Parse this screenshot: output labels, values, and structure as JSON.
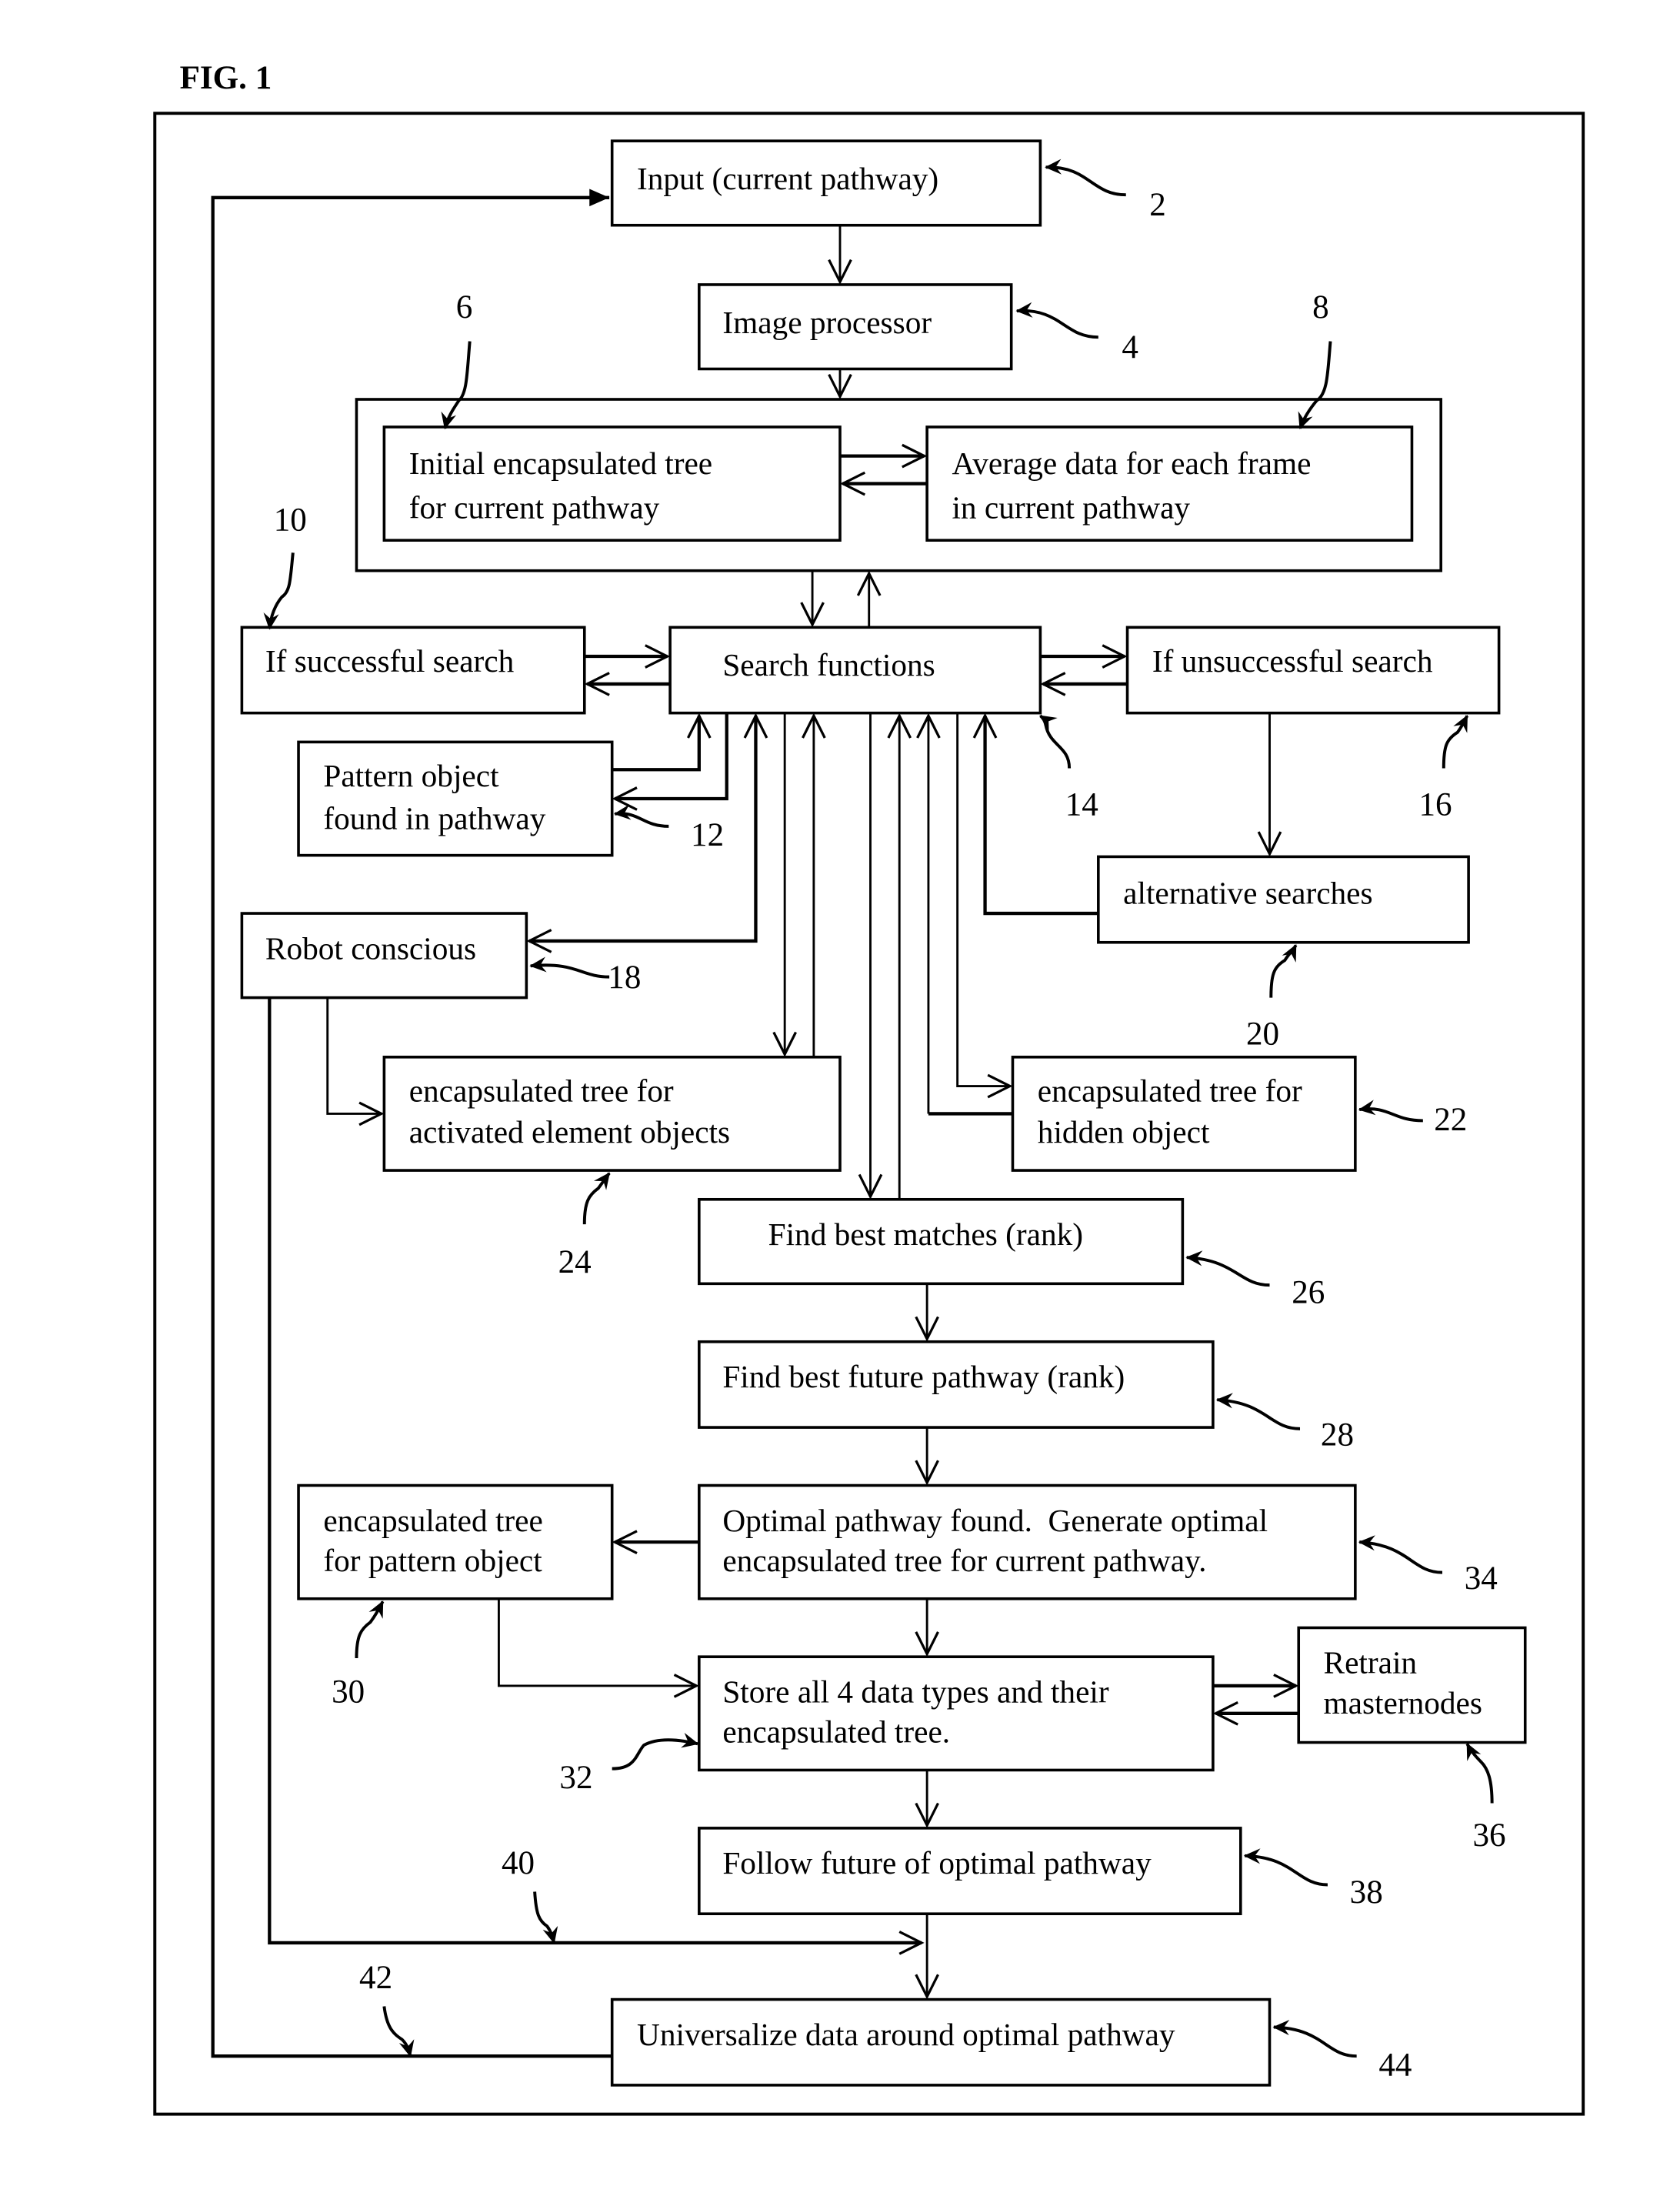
{
  "figure_label": "FIG. 1",
  "boxes": {
    "input": {
      "lines": [
        "Input (current pathway)"
      ],
      "ref": "2"
    },
    "image_processor": {
      "lines": [
        "Image processor"
      ],
      "ref": "4"
    },
    "initial_tree": {
      "lines": [
        "Initial encapsulated tree",
        "for current pathway"
      ],
      "ref": "6"
    },
    "average_data": {
      "lines": [
        "Average data for each frame",
        "in current pathway"
      ],
      "ref": "8"
    },
    "successful_search": {
      "lines": [
        "If successful search"
      ],
      "ref": "10"
    },
    "pattern_found": {
      "lines": [
        "Pattern object",
        "found in pathway"
      ],
      "ref": "12"
    },
    "search_functions": {
      "lines": [
        "Search functions"
      ],
      "ref": "14"
    },
    "unsuccessful_search": {
      "lines": [
        "If unsuccessful search"
      ],
      "ref": "16"
    },
    "robot_conscious": {
      "lines": [
        "Robot conscious"
      ],
      "ref": "18"
    },
    "alternative_searches": {
      "lines": [
        "alternative searches"
      ],
      "ref": "20"
    },
    "hidden_object_tree": {
      "lines": [
        "encapsulated tree for",
        "hidden object"
      ],
      "ref": "22"
    },
    "activated_tree": {
      "lines": [
        "encapsulated tree for",
        "activated element objects"
      ],
      "ref": "24"
    },
    "best_matches": {
      "lines": [
        "Find best matches (rank)"
      ],
      "ref": "26"
    },
    "best_future": {
      "lines": [
        "Find best future pathway (rank)"
      ],
      "ref": "28"
    },
    "pattern_object_tree": {
      "lines": [
        "encapsulated tree",
        "for pattern object"
      ],
      "ref": "30"
    },
    "store_data": {
      "lines": [
        "Store all 4 data types and their",
        "encapsulated tree."
      ],
      "ref": "32"
    },
    "optimal_found": {
      "lines": [
        "Optimal pathway found.  Generate optimal",
        "encapsulated tree for current pathway."
      ],
      "ref": "34"
    },
    "retrain": {
      "lines": [
        "Retrain",
        "masternodes"
      ],
      "ref": "36"
    },
    "follow_future": {
      "lines": [
        "Follow future of optimal pathway"
      ],
      "ref": "38"
    },
    "universalize": {
      "lines": [
        "Universalize data around optimal pathway"
      ],
      "ref": "44"
    }
  },
  "path_refs": {
    "robot_to_universalize": "40",
    "universalize_to_input": "42"
  }
}
